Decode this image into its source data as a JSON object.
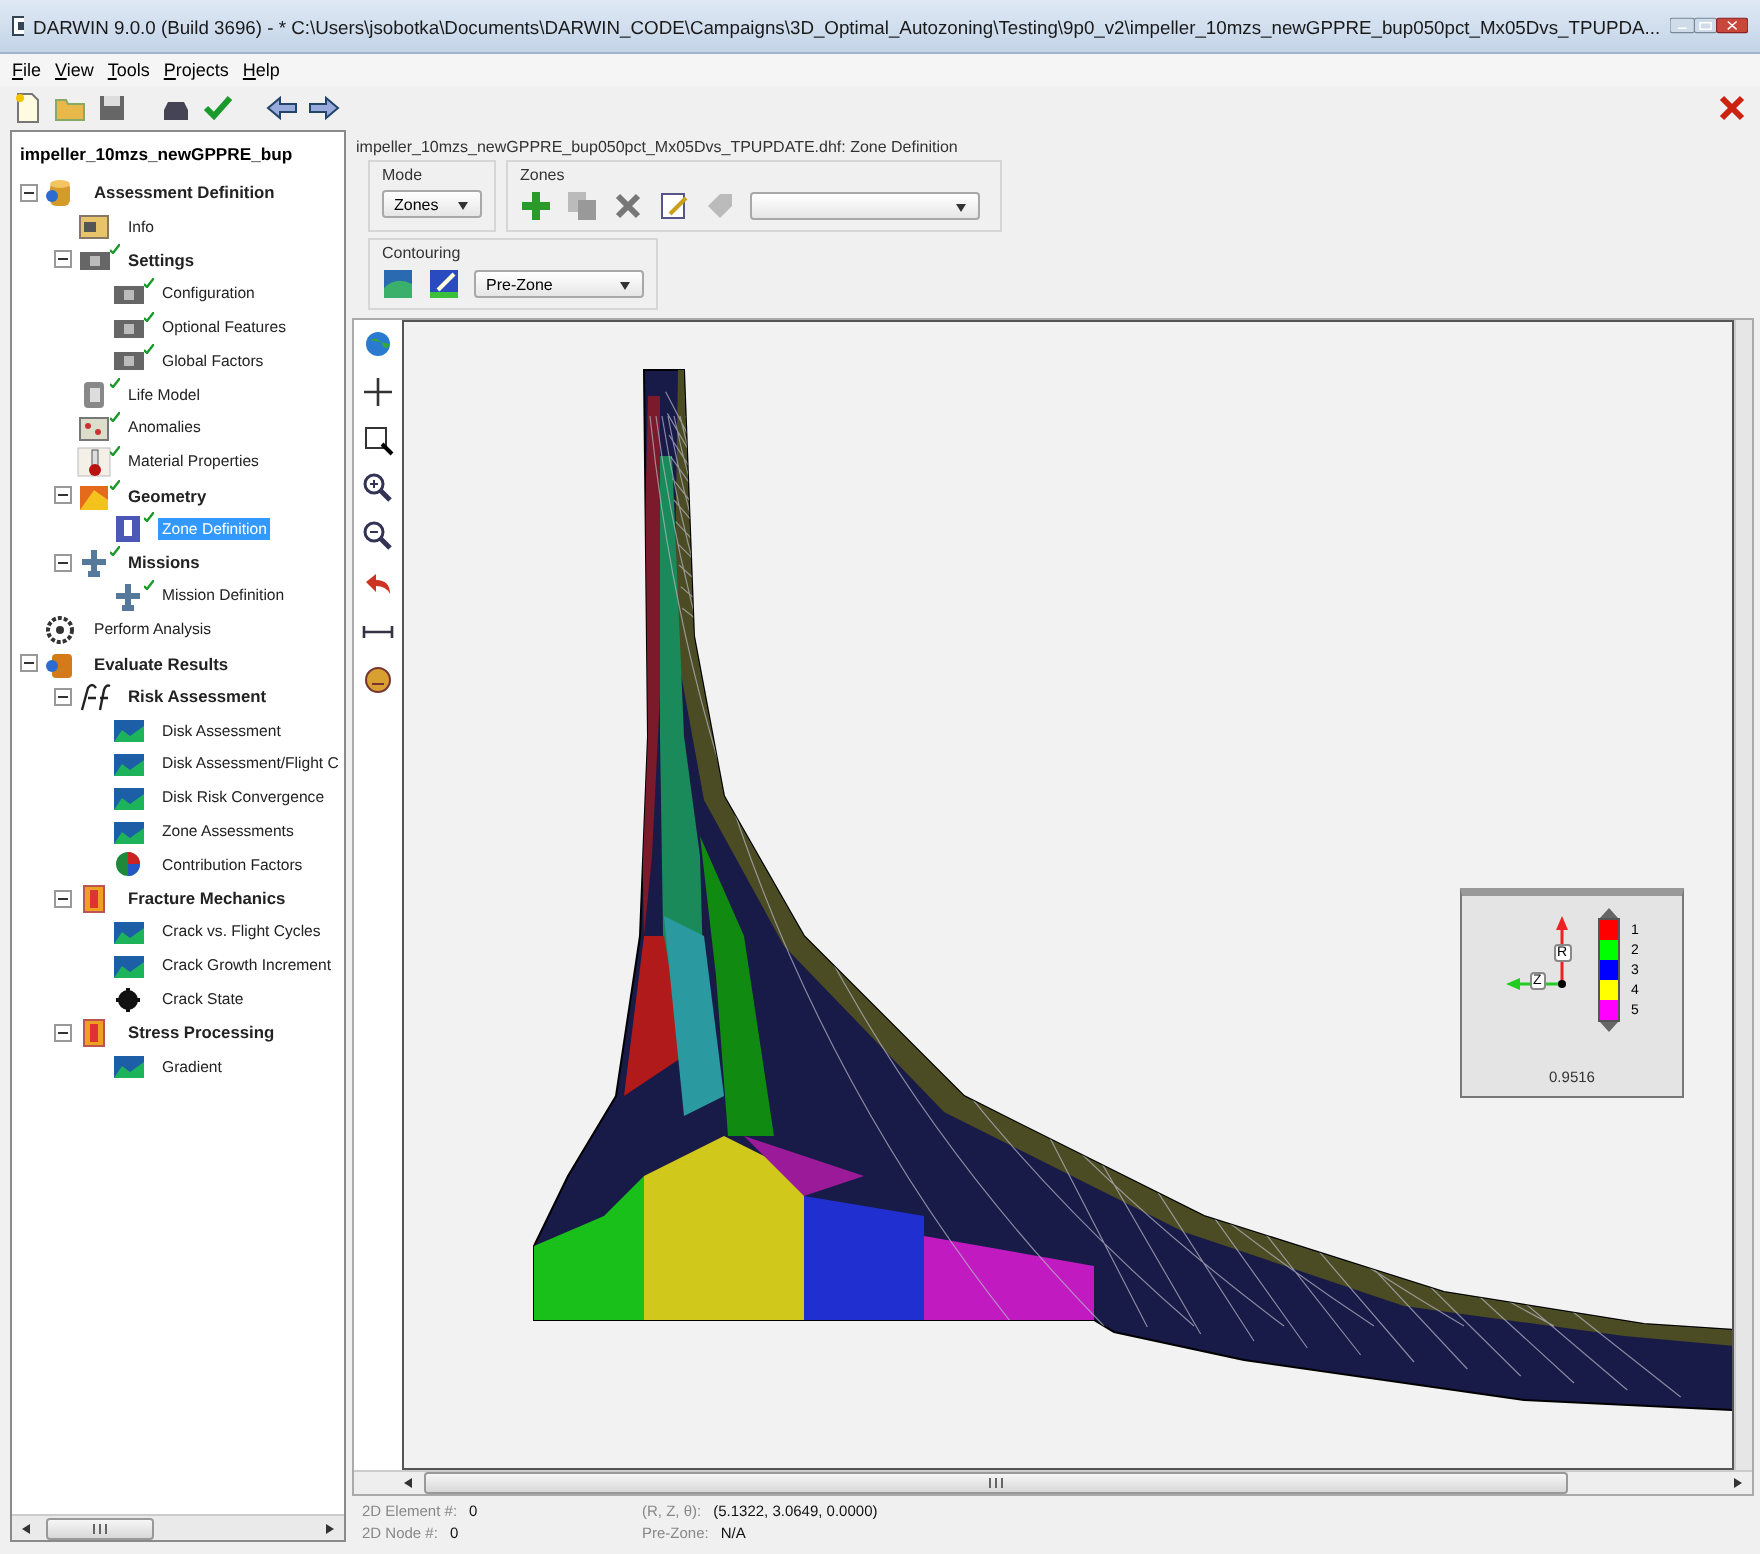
{
  "window": {
    "title": "DARWIN 9.0.0 (Build 3696) - * C:\\Users\\jsobotka\\Documents\\DARWIN_CODE\\Campaigns\\3D_Optimal_Autozoning\\Testing\\9p0_v2\\impeller_10mzs_newGPPRE_bup050pct_Mx05Dvs_TPUPDA..."
  },
  "menu": [
    "File",
    "View",
    "Tools",
    "Projects",
    "Help"
  ],
  "tree": {
    "root": "impeller_10mzs_newGPPRE_bup",
    "items": [
      {
        "label": "Assessment Definition",
        "kind": "database",
        "checked": false,
        "selected": false,
        "expanded": true,
        "children": [
          {
            "label": "Info",
            "kind": "info",
            "checked": false,
            "selected": false
          },
          {
            "label": "Settings",
            "kind": "panel",
            "checked": true,
            "selected": false,
            "expanded": true,
            "children": [
              {
                "label": "Configuration",
                "kind": "panel",
                "checked": true,
                "selected": false
              },
              {
                "label": "Optional Features",
                "kind": "panel",
                "checked": true,
                "selected": false
              },
              {
                "label": "Global Factors",
                "kind": "panel",
                "checked": true,
                "selected": false
              }
            ]
          },
          {
            "label": "Life Model",
            "kind": "life",
            "checked": true,
            "selected": false
          },
          {
            "label": "Anomalies",
            "kind": "anomaly",
            "checked": true,
            "selected": false
          },
          {
            "label": "Material Properties",
            "kind": "thermometer",
            "checked": true,
            "selected": false
          },
          {
            "label": "Geometry",
            "kind": "geometry",
            "checked": true,
            "selected": false,
            "expanded": true,
            "children": [
              {
                "label": "Zone Definition",
                "kind": "zone",
                "checked": true,
                "selected": true
              }
            ]
          },
          {
            "label": "Missions",
            "kind": "mission",
            "checked": true,
            "selected": false,
            "expanded": true,
            "children": [
              {
                "label": "Mission Definition",
                "kind": "mission",
                "checked": true,
                "selected": false
              }
            ]
          }
        ]
      },
      {
        "label": "Perform Analysis",
        "kind": "gear",
        "checked": false,
        "selected": false
      },
      {
        "label": "Evaluate Results",
        "kind": "results",
        "checked": false,
        "selected": false,
        "expanded": true,
        "children": [
          {
            "label": "Risk Assessment",
            "kind": "pf",
            "checked": false,
            "selected": false,
            "expanded": true,
            "children": [
              {
                "label": "Disk Assessment",
                "kind": "chart",
                "checked": false,
                "selected": false
              },
              {
                "label": "Disk Assessment/Flight C",
                "kind": "chart",
                "checked": false,
                "selected": false
              },
              {
                "label": "Disk Risk Convergence",
                "kind": "chart",
                "checked": false,
                "selected": false
              },
              {
                "label": "Zone Assessments",
                "kind": "chart",
                "checked": false,
                "selected": false
              },
              {
                "label": "Contribution Factors",
                "kind": "pie",
                "checked": false,
                "selected": false
              }
            ]
          },
          {
            "label": "Fracture Mechanics",
            "kind": "gauge",
            "checked": false,
            "selected": false,
            "expanded": true,
            "children": [
              {
                "label": "Crack vs. Flight Cycles",
                "kind": "chart",
                "checked": false,
                "selected": false
              },
              {
                "label": "Crack Growth Increment",
                "kind": "chart",
                "checked": false,
                "selected": false
              },
              {
                "label": "Crack State",
                "kind": "blob",
                "checked": false,
                "selected": false
              }
            ]
          },
          {
            "label": "Stress Processing",
            "kind": "gauge",
            "checked": false,
            "selected": false,
            "expanded": true,
            "children": [
              {
                "label": "Gradient",
                "kind": "chart",
                "checked": false,
                "selected": false
              }
            ]
          }
        ]
      }
    ]
  },
  "editor": {
    "path": "impeller_10mzs_newGPPRE_bup050pct_Mx05Dvs_TPUPDATE.dhf: Zone Definition",
    "mode": {
      "label": "Mode",
      "value": "Zones"
    },
    "zones": {
      "label": "Zones"
    },
    "contouring": {
      "label": "Contouring",
      "value": "Pre-Zone"
    }
  },
  "legend": {
    "axes": [
      "R",
      "Z"
    ],
    "value": "0.9516",
    "bands": [
      {
        "label": "1",
        "color": "#ff0000"
      },
      {
        "label": "2",
        "color": "#00ff00"
      },
      {
        "label": "3",
        "color": "#0000ff"
      },
      {
        "label": "4",
        "color": "#ffff00"
      },
      {
        "label": "5",
        "color": "#ff00ff"
      }
    ]
  },
  "status": [
    {
      "label": "2D Element #:",
      "value": "0"
    },
    {
      "label": "(R, Z, θ):",
      "value": "(5.1322, 3.0649, 0.0000)"
    },
    {
      "label": "2D Node #:",
      "value": "0"
    },
    {
      "label": "Pre-Zone:",
      "value": "N/A"
    }
  ]
}
